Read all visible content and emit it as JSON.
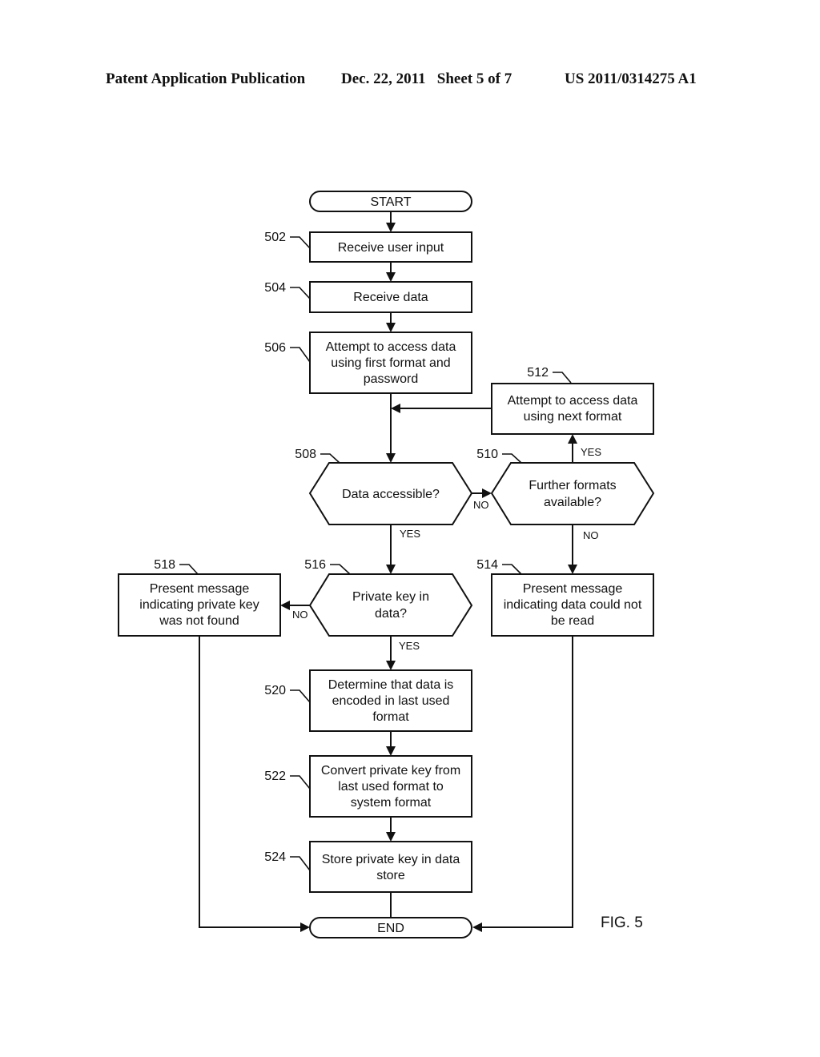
{
  "header": {
    "publication": "Patent Application Publication",
    "date_sheet": "Dec. 22, 2011   Sheet 5 of 7",
    "number": "US 2011/0314275 A1"
  },
  "figure_label": "FIG. 5",
  "nodes": {
    "start": {
      "lines": [
        "START"
      ]
    },
    "n502": {
      "ref": "502",
      "lines": [
        "Receive user input"
      ]
    },
    "n504": {
      "ref": "504",
      "lines": [
        "Receive data"
      ]
    },
    "n506": {
      "ref": "506",
      "lines": [
        "Attempt to access data",
        "using first format and",
        "password"
      ]
    },
    "n508": {
      "ref": "508",
      "lines": [
        "Data accessible?"
      ]
    },
    "n510": {
      "ref": "510",
      "lines": [
        "Further formats",
        "available?"
      ]
    },
    "n512": {
      "ref": "512",
      "lines": [
        "Attempt to access data",
        "using next format"
      ]
    },
    "n514": {
      "ref": "514",
      "lines": [
        "Present message",
        "indicating data could not",
        "be read"
      ]
    },
    "n516": {
      "ref": "516",
      "lines": [
        "Private key in",
        "data?"
      ]
    },
    "n518": {
      "ref": "518",
      "lines": [
        "Present message",
        "indicating private key",
        "was not found"
      ]
    },
    "n520": {
      "ref": "520",
      "lines": [
        "Determine that data is",
        "encoded in last used",
        "format"
      ]
    },
    "n522": {
      "ref": "522",
      "lines": [
        "Convert private key from",
        "last used format to",
        "system format"
      ]
    },
    "n524": {
      "ref": "524",
      "lines": [
        "Store private key in data",
        "store"
      ]
    },
    "end": {
      "lines": [
        "END"
      ]
    }
  },
  "edge_labels": {
    "e508_no": "NO",
    "e508_yes": "YES",
    "e510_yes": "YES",
    "e510_no": "NO",
    "e516_no": "NO",
    "e516_yes": "YES"
  }
}
